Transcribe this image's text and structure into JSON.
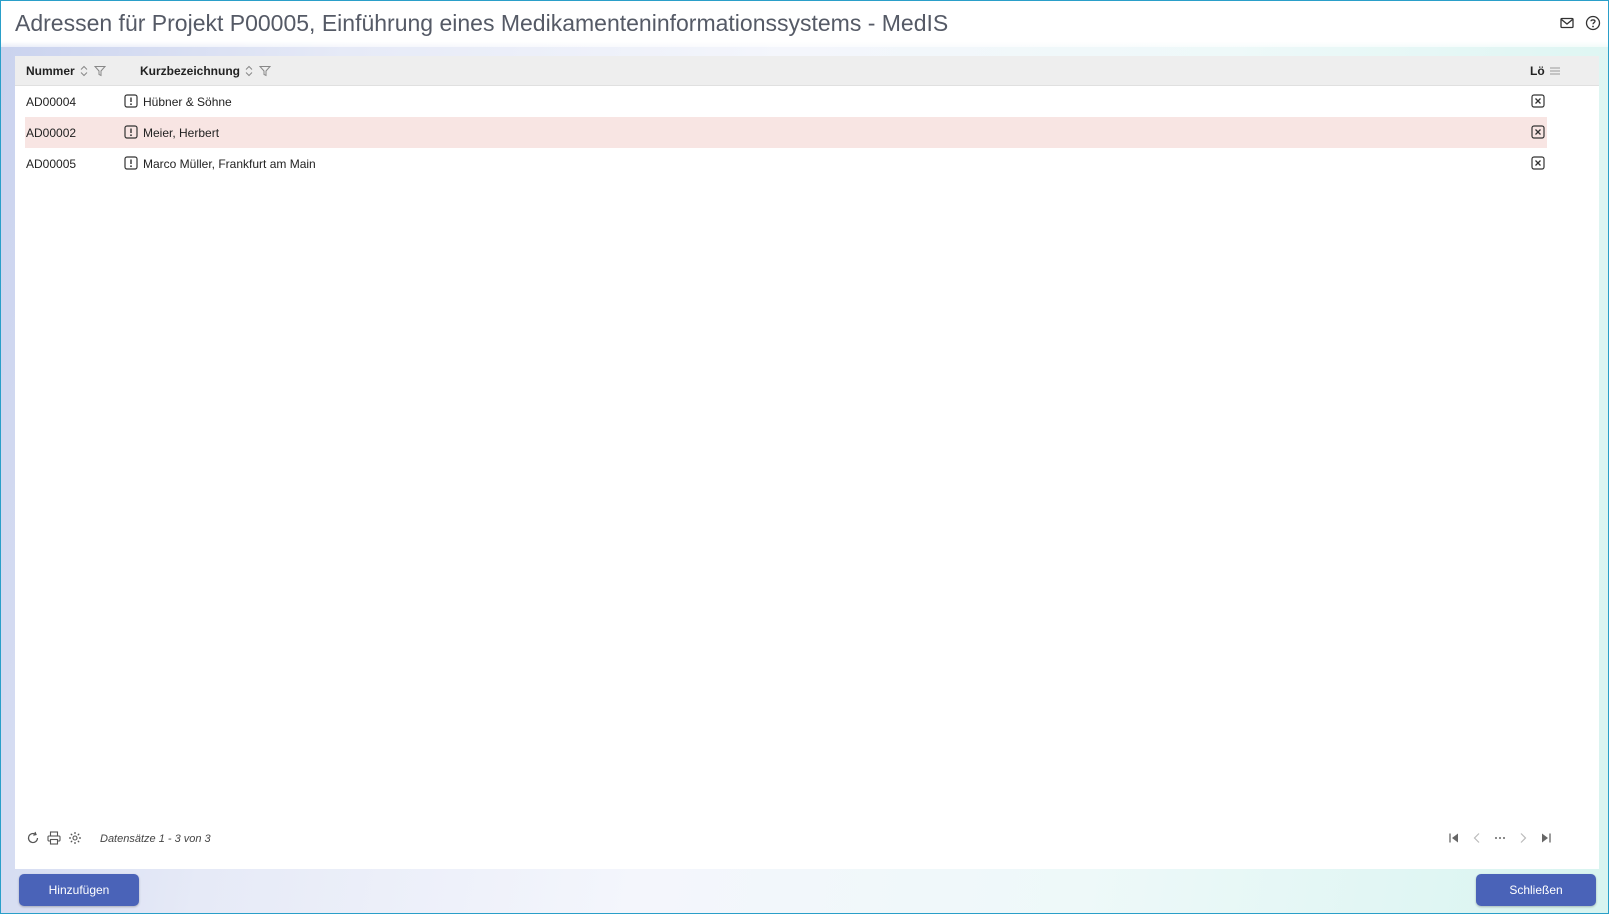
{
  "window": {
    "title": "Adressen für Projekt P00005, Einführung eines Medikamenteninformationssystems - MedIS",
    "icons": [
      "mail-icon",
      "help-icon"
    ]
  },
  "grid": {
    "columns": {
      "nummer": "Nummer",
      "kurzbezeichnung": "Kurzbezeichnung",
      "loeschen": "Lö"
    },
    "rows": [
      {
        "nummer": "AD00004",
        "kurzbezeichnung": "Hübner & Söhne",
        "selected": false
      },
      {
        "nummer": "AD00002",
        "kurzbezeichnung": "Meier, Herbert",
        "selected": true
      },
      {
        "nummer": "AD00005",
        "kurzbezeichnung": "Marco Müller, Frankfurt am Main",
        "selected": false
      }
    ]
  },
  "footer": {
    "records": "Datensätze 1 - 3 von 3",
    "tools": [
      "refresh-icon",
      "print-icon",
      "settings-icon"
    ],
    "pager": [
      "first-page-icon",
      "prev-page-icon",
      "more-icon",
      "next-page-icon",
      "last-page-icon"
    ]
  },
  "buttons": {
    "add": "Hinzufügen",
    "close": "Schließen"
  },
  "colors": {
    "accent": "#4a63b8",
    "selected_row": "#f8e5e3",
    "header_bg": "#eeeeee",
    "border": "#2a9fc9"
  }
}
